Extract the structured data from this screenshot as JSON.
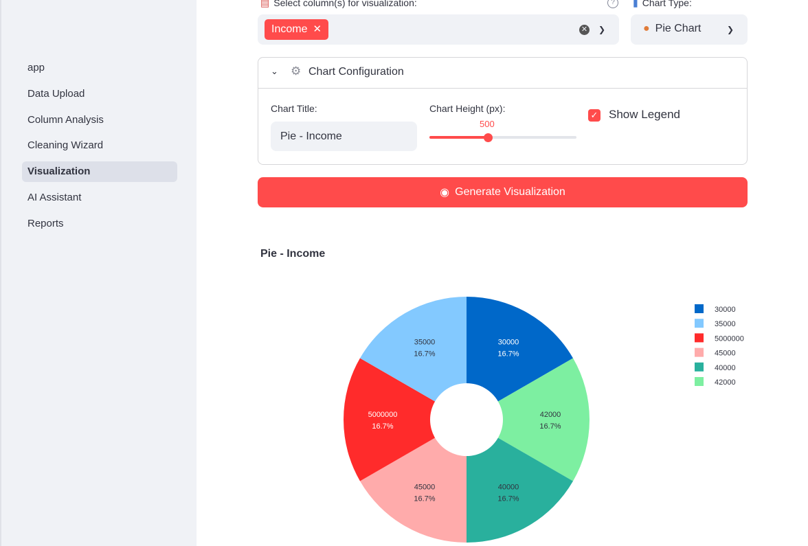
{
  "sidebar": {
    "items": [
      {
        "label": "app",
        "active": false
      },
      {
        "label": "Data Upload",
        "active": false
      },
      {
        "label": "Column Analysis",
        "active": false
      },
      {
        "label": "Cleaning Wizard",
        "active": false
      },
      {
        "label": "Visualization",
        "active": true
      },
      {
        "label": "AI Assistant",
        "active": false
      },
      {
        "label": "Reports",
        "active": false
      }
    ]
  },
  "controls": {
    "columns_label": "Select column(s) for visualization:",
    "selected_tag": "Income",
    "chart_type_label": "Chart Type:",
    "chart_type_value": "Pie Chart"
  },
  "config": {
    "expander_title": "Chart Configuration",
    "title_label": "Chart Title:",
    "title_value": "Pie - Income",
    "height_label": "Chart Height (px):",
    "height_value": "500",
    "height_fraction": 0.4,
    "legend_label": "Show Legend",
    "legend_checked": true
  },
  "generate_button": "Generate Visualization",
  "colors": {
    "accent": "#ff4b4b",
    "sidebar_bg": "#f0f2f6"
  },
  "chart_data": {
    "type": "pie",
    "title": "Pie - Income",
    "donut": true,
    "legend_position": "right",
    "slices": [
      {
        "label": "30000",
        "value": 1,
        "percent": "16.7%",
        "color": "#0068c9"
      },
      {
        "label": "42000",
        "value": 1,
        "percent": "16.7%",
        "color": "#7defa1"
      },
      {
        "label": "40000",
        "value": 1,
        "percent": "16.7%",
        "color": "#29b09d"
      },
      {
        "label": "45000",
        "value": 1,
        "percent": "16.7%",
        "color": "#ffabab"
      },
      {
        "label": "5000000",
        "value": 1,
        "percent": "16.7%",
        "color": "#ff2b2b"
      },
      {
        "label": "35000",
        "value": 1,
        "percent": "16.7%",
        "color": "#83c9ff"
      }
    ],
    "legend_order": [
      "30000",
      "35000",
      "5000000",
      "45000",
      "40000",
      "42000"
    ]
  }
}
